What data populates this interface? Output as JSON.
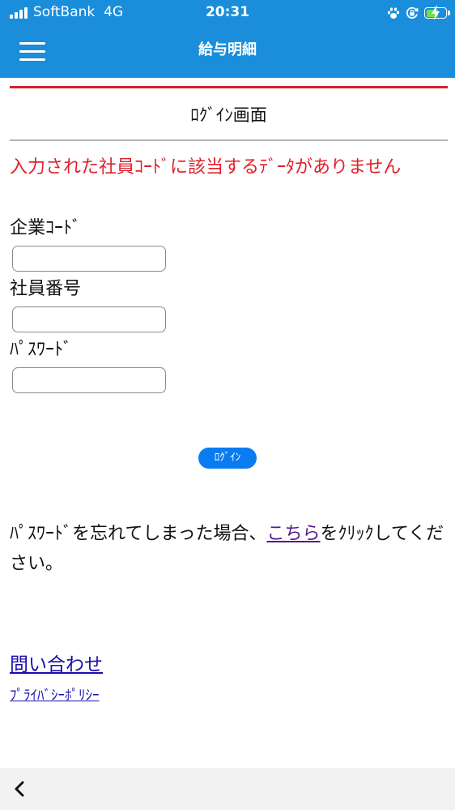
{
  "status_bar": {
    "carrier": "SoftBank",
    "network": "4G",
    "time": "20:31",
    "icons": [
      "signal-icon",
      "paw-icon",
      "orientation-lock-icon",
      "battery-charging-icon"
    ],
    "battery_color": "#6be04a"
  },
  "header": {
    "title": "給与明細",
    "menu_icon": "hamburger-menu-icon",
    "background_color": "#1a8edb"
  },
  "screen": {
    "title": "ﾛｸﾞｲﾝ画面",
    "error_message": "入力された社員ｺｰﾄﾞに該当するﾃﾞｰﾀがありません",
    "error_color": "#e0202a",
    "accent_rule_color": "#d6202a"
  },
  "form": {
    "company_code_label": "企業ｺｰﾄﾞ",
    "company_code_value": "",
    "employee_number_label": "社員番号",
    "employee_number_value": "",
    "password_label": "ﾊﾟｽﾜｰﾄﾞ",
    "password_value": "",
    "login_button_label": "ﾛｸﾞｲﾝ",
    "login_button_color": "#0a7cf0"
  },
  "forgot_password": {
    "before_link": "ﾊﾟｽﾜｰﾄﾞを忘れてしまった場合、",
    "link_text": "こちら",
    "after_link": "をｸﾘｯｸしてください。"
  },
  "footer_links": {
    "contact": "問い合わせ",
    "privacy": "ﾌﾟﾗｲﾊﾞｼｰﾎﾟﾘｼｰ"
  },
  "toolbar": {
    "back_icon": "chevron-left-icon"
  }
}
